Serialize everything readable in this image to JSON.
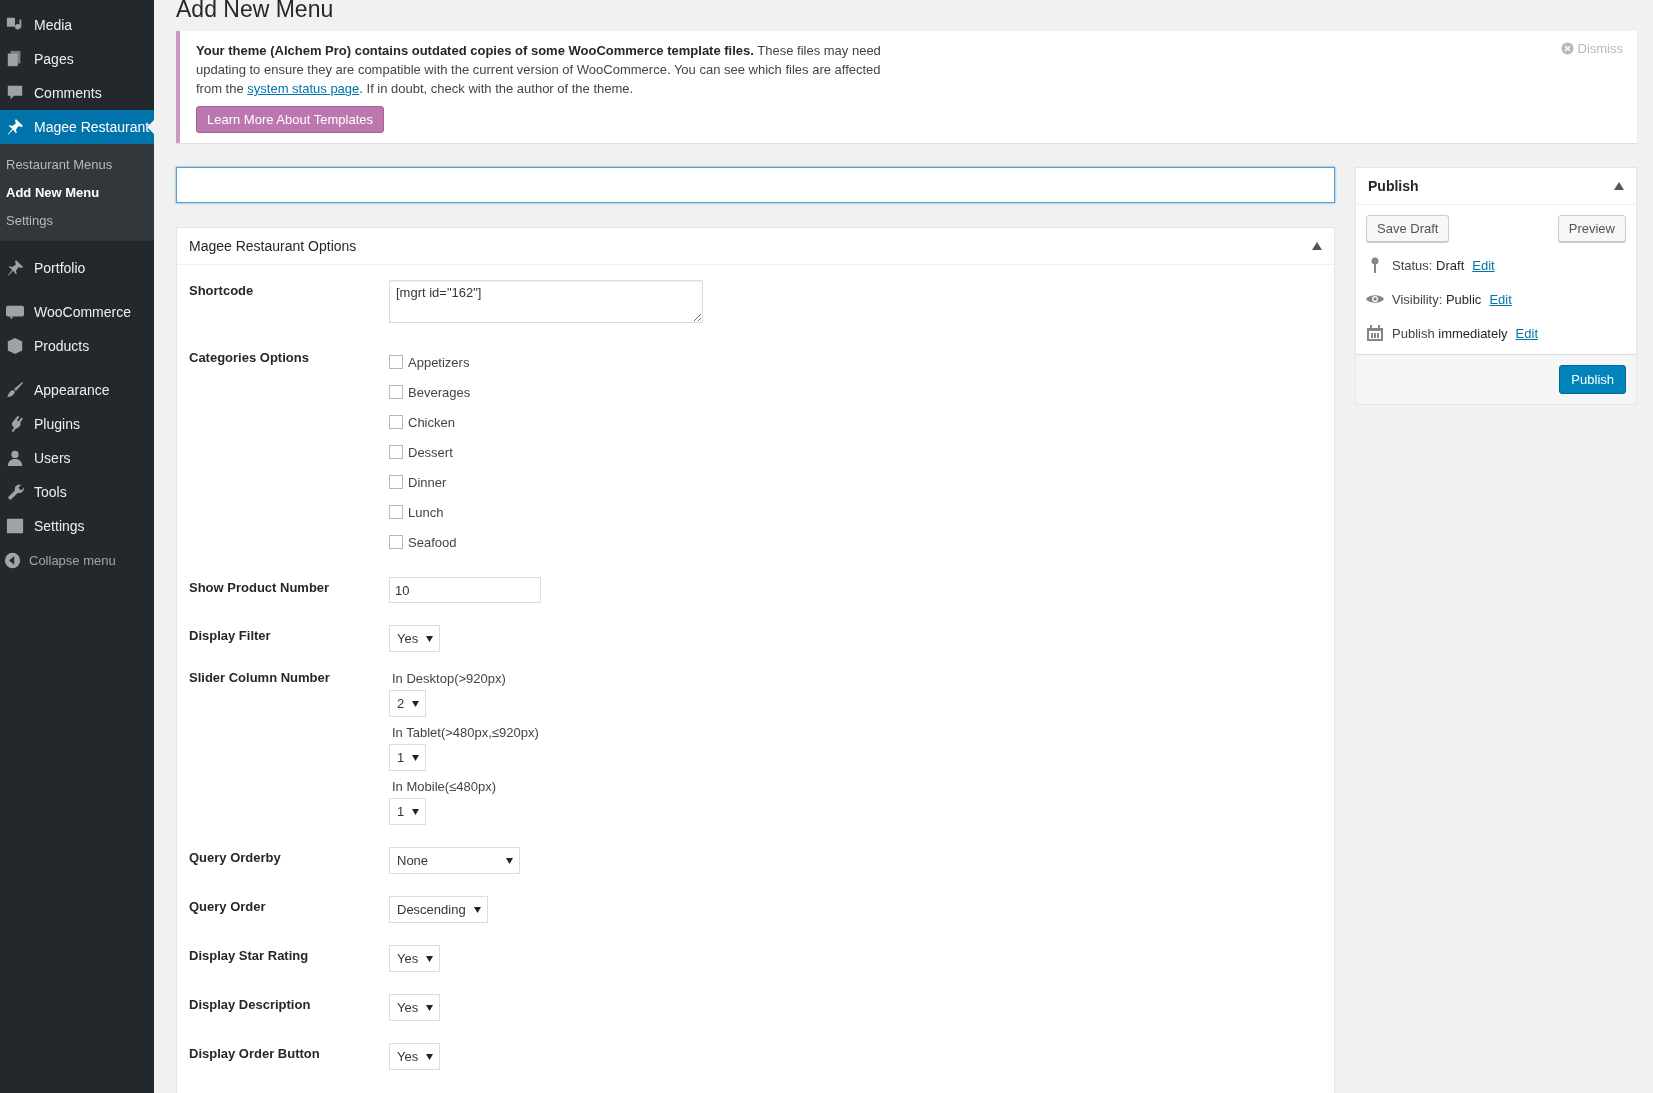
{
  "sidebar": {
    "items": [
      {
        "label": "Media",
        "selected": false
      },
      {
        "label": "Pages",
        "selected": false
      },
      {
        "label": "Comments",
        "selected": false
      },
      {
        "label": "Magee Restaurant",
        "selected": true,
        "children": [
          {
            "label": "Restaurant Menus",
            "selected": false
          },
          {
            "label": "Add New Menu",
            "selected": true
          },
          {
            "label": "Settings",
            "selected": false
          }
        ]
      },
      {
        "label": "Portfolio",
        "selected": false
      },
      {
        "label": "WooCommerce",
        "selected": false
      },
      {
        "label": "Products",
        "selected": false
      },
      {
        "label": "Appearance",
        "selected": false
      },
      {
        "label": "Plugins",
        "selected": false
      },
      {
        "label": "Users",
        "selected": false
      },
      {
        "label": "Tools",
        "selected": false
      },
      {
        "label": "Settings",
        "selected": false
      }
    ],
    "collapse": "Collapse menu"
  },
  "page_title": "Add New Menu",
  "notice": {
    "text": "**Your theme (Alchem Pro) contains outdated copies of some WooCommerce template files.** These files may need updating to ensure they are compatible with the current version of WooCommerce. You can see which files are affected from the ",
    "link": "system status page",
    "text_after": ". If in doubt, check with the author of the theme.",
    "button": "Learn More About Templates",
    "dismiss": "Dismiss"
  },
  "options": {
    "title": "Magee Restaurant Options",
    "fields": [
      {
        "kind": "textarea",
        "label": "Shortcode",
        "value": "[mgrt id=\"162\"]"
      },
      {
        "kind": "checkboxes",
        "label": "Categories Options",
        "items": [
          {
            "label": "Appetizers",
            "checked": false
          },
          {
            "label": "Beverages",
            "checked": false
          },
          {
            "label": "Chicken",
            "checked": false
          },
          {
            "label": "Dessert",
            "checked": false
          },
          {
            "label": "Dinner",
            "checked": false
          },
          {
            "label": "Lunch",
            "checked": false
          },
          {
            "label": "Seafood",
            "checked": false
          }
        ]
      },
      {
        "kind": "text",
        "label": "Show Product Number",
        "value": "10"
      },
      {
        "kind": "select",
        "label": "Display Filter",
        "value": "Yes"
      },
      {
        "kind": "responsive",
        "label": "Slider Column Number",
        "groups": [
          {
            "label": "In Desktop(>920px)",
            "value": "2"
          },
          {
            "label": "In Tablet(>480px,≤920px)",
            "value": "1"
          },
          {
            "label": "In Mobile(≤480px)",
            "value": "1"
          }
        ]
      },
      {
        "kind": "select",
        "label": "Query Orderby",
        "value": "None"
      },
      {
        "kind": "select",
        "label": "Query Order",
        "value": "Descending"
      },
      {
        "kind": "select",
        "label": "Display Star Rating",
        "value": "Yes"
      },
      {
        "kind": "select",
        "label": "Display Description",
        "value": "Yes"
      },
      {
        "kind": "select",
        "label": "Display Order Button",
        "value": "Yes"
      }
    ]
  },
  "publish": {
    "title": "Publish",
    "save_draft": "Save Draft",
    "preview": "Preview",
    "status_label": "Status: ",
    "status": "Draft",
    "visibility_label": "Visibility: ",
    "visibility": "Public",
    "schedule": "Publish ",
    "schedule_value": "immediately",
    "status_edit": "Edit",
    "visibility_edit": "Edit",
    "schedule_edit": "Edit",
    "publish_button": "Publish"
  }
}
